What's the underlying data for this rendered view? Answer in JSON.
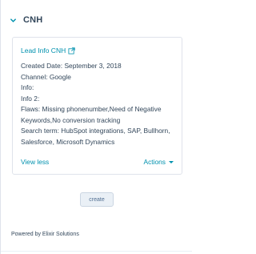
{
  "section": {
    "title": "CNH",
    "icon": "chevron-down-icon"
  },
  "card": {
    "title": "Lead Info CNH",
    "title_icon": "external-link-icon",
    "fields": [
      {
        "label": "Created Date:",
        "value": "September 3, 2018"
      },
      {
        "label": "Channel:",
        "value": "Google"
      },
      {
        "label": "Info:",
        "value": ""
      },
      {
        "label": "Info 2:",
        "value": ""
      },
      {
        "label": "Flaws:",
        "value": "Missing phonenumber,Need of Negative Keywords,No conversion tracking"
      },
      {
        "label": "Search term:",
        "value": "HubSpot integrations, SAP, Bullhorn, Salesforce, Microsoft Dynamics"
      }
    ],
    "view_less_label": "View less",
    "actions_label": "Actions"
  },
  "create_label": "create",
  "powered_by": "Powered by Elixir Solutions",
  "colors": {
    "link": "#0091ae",
    "text": "#33475b",
    "border": "#dfe3eb",
    "button_bg": "#eaf0f6"
  }
}
